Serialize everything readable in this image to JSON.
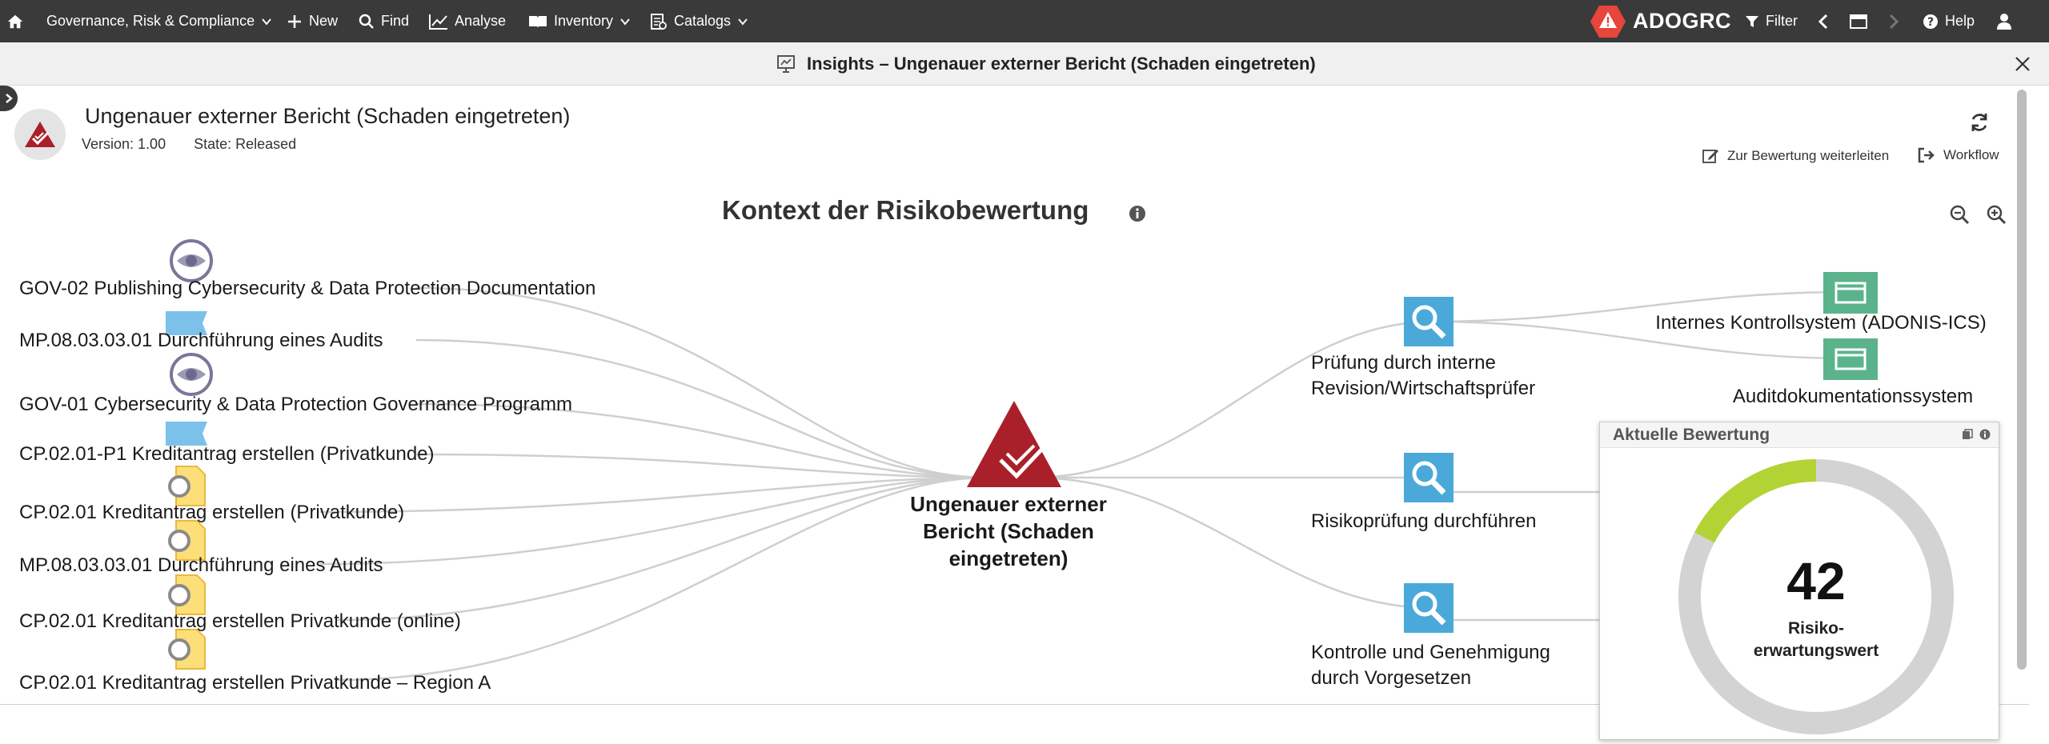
{
  "topbar": {
    "menu": [
      {
        "label": "Governance, Risk & Compliance",
        "icon": "chevron-down-icon"
      },
      {
        "label": "New",
        "icon": "plus-icon"
      },
      {
        "label": "Find",
        "icon": "search-icon"
      },
      {
        "label": "Analyse",
        "icon": "chart-line-icon"
      },
      {
        "label": "Inventory",
        "icon": "book-icon"
      },
      {
        "label": "Catalogs",
        "icon": "catalog-icon"
      }
    ],
    "brand": "ADOGRC",
    "filter_label": "Filter",
    "help_label": "Help"
  },
  "titlebar": {
    "title": "Insights – Ungenauer externer Bericht (Schaden eingetreten)"
  },
  "header": {
    "title": "Ungenauer externer Bericht (Schaden eingetreten)",
    "version": "Version: 1.00",
    "state": "State: Released",
    "action_forward": "Zur Bewertung weiterleiten",
    "action_workflow": "Workflow"
  },
  "section": {
    "title": "Kontext der Risikobewertung"
  },
  "graph": {
    "center_label": "Ungenauer externer Bericht (Schaden eingetreten)",
    "left_nodes": [
      {
        "label": "GOV-02 Publishing Cybersecurity & Data Protection Documentation",
        "icon": "eye-icon"
      },
      {
        "label": "MP.08.03.03.01 Durchführung eines Audits",
        "icon": "flag-icon"
      },
      {
        "label": "GOV-01 Cybersecurity & Data Protection Governance Programm",
        "icon": "eye-icon"
      },
      {
        "label": "CP.02.01-P1 Kreditantrag erstellen (Privatkunde)",
        "icon": "flag-icon"
      },
      {
        "label": "CP.02.01 Kreditantrag erstellen (Privatkunde)",
        "icon": "document-icon"
      },
      {
        "label": "MP.08.03.03.01 Durchführung eines Audits",
        "icon": "document-icon"
      },
      {
        "label": "CP.02.01 Kreditantrag erstellen Privatkunde (online)",
        "icon": "document-icon"
      },
      {
        "label": "CP.02.01 Kreditantrag erstellen Privatkunde – Region A",
        "icon": "document-icon"
      }
    ],
    "right_nodes": [
      {
        "label": "Prüfung durch interne Revision/Wirtschaftsprüfer",
        "icon": "magnifier-icon"
      },
      {
        "label": "Risikoprüfung durchführen",
        "icon": "magnifier-icon"
      },
      {
        "label": "Kontrolle und Genehmigung durch Vorgesetzen",
        "icon": "magnifier-icon"
      }
    ],
    "system_nodes": [
      {
        "label": "Internes Kontrollsystem (ADONIS-ICS)",
        "icon": "window-icon"
      },
      {
        "label": "Auditdokumentationssystem",
        "icon": "window-icon"
      }
    ]
  },
  "widget": {
    "title": "Aktuelle Bewertung",
    "value": "42",
    "label": "Risiko-\nerwartungswert"
  },
  "colors": {
    "topbar_bg": "#3a3a3a",
    "brand_accent": "#e8453c",
    "risk_red": "#a9202a",
    "activity_blue": "#4aa9d9",
    "system_green": "#5bb38c",
    "gauge_green": "#b3d334",
    "gauge_track": "#d3d3d3"
  }
}
